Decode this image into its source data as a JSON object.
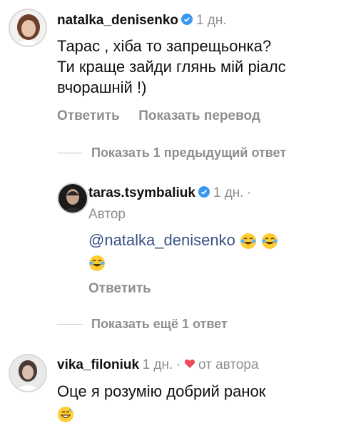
{
  "comments": [
    {
      "username": "natalka_denisenko",
      "time": "1 дн.",
      "lines": [
        "Тарас , хіба то запрещьонка?",
        "Ти краще зайди глянь мій ріалс",
        "вчорашній !)"
      ],
      "actions": {
        "reply": "Ответить",
        "translate": "Показать перевод"
      },
      "thread_toggle": "Показать 1 предыдущий ответ"
    }
  ],
  "reply": {
    "username": "taras.tsymbaliuk",
    "time": "1 дн.",
    "separator": "·",
    "author_label": "Автор",
    "mention": "@natalka_denisenko",
    "emoji": [
      "face-with-tears-of-joy",
      "face-with-tears-of-joy",
      "face-with-tears-of-joy"
    ],
    "reply_action": "Ответить",
    "thread_toggle": "Показать ещё 1 ответ"
  },
  "last_comment": {
    "username": "vika_filoniuk",
    "time": "1 дн.",
    "separator": "·",
    "liked_by_author": "от автора",
    "text": "Оце я розумію добрий ранок",
    "emoji": [
      "grinning-face-with-sweat"
    ]
  },
  "colors": {
    "verified": "#3897f0",
    "heart": "#ed4956",
    "secondary": "#8e8e8e",
    "mention": "#385185"
  }
}
